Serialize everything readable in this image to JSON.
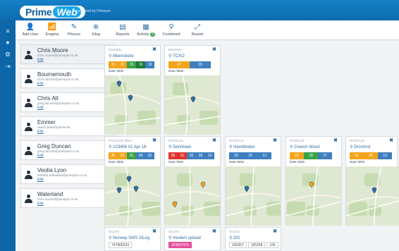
{
  "brand": {
    "prime": "Prime",
    "web": "Web",
    "powered": "powered by Primayer"
  },
  "colors": {
    "orange": "#f2a51c",
    "green": "#3aa34a",
    "darkgreen": "#1d7a3a",
    "blue": "#3f7fbf",
    "red": "#e0362c",
    "pink": "#e64f9b"
  },
  "toolbar": [
    {
      "label": "Add User",
      "icon": "user-plus-icon",
      "glyph": "👤"
    },
    {
      "label": "Enigma",
      "icon": "bars-icon",
      "glyph": "📶"
    },
    {
      "label": "Phocus",
      "icon": "edit-icon",
      "glyph": "✎"
    },
    {
      "label": "Xilog",
      "icon": "plus-circle-icon",
      "glyph": "⊕"
    },
    {
      "label": "Reports",
      "icon": "report-icon",
      "glyph": "▤"
    },
    {
      "label": "Activity",
      "icon": "activity-icon",
      "glyph": "▦",
      "badge": "3"
    },
    {
      "label": "Combined",
      "icon": "pin-icon",
      "glyph": "⚲"
    },
    {
      "label": "Resize",
      "icon": "resize-icon",
      "glyph": "⤢"
    }
  ],
  "sidenav": [
    {
      "icon": "menu-icon",
      "glyph": "≡"
    },
    {
      "icon": "globe-icon",
      "glyph": "●"
    },
    {
      "icon": "cogs-icon",
      "glyph": "⚙"
    },
    {
      "icon": "logout-icon",
      "glyph": "⇥"
    }
  ],
  "users": [
    {
      "name": "Chris Moore",
      "email": "chris.moore@primayer.co.uk",
      "edit": "Edit"
    },
    {
      "name": "Bournemouth",
      "email": "Chris.Moore@primayer.co.uk",
      "edit": "Edit"
    },
    {
      "name": "Chris Alt",
      "email": "greg.duncan@primayer.co.uk",
      "edit": "Edit"
    },
    {
      "name": "Emmer",
      "email": "switch.base@primer.be",
      "edit": "Edit"
    },
    {
      "name": "Greg Duncan",
      "email": "greg.duncan@primayer.co.uk",
      "edit": "Edit"
    },
    {
      "name": "Veolia Lyon",
      "email": "barbara.hathaway@primayer.co.uk",
      "edit": "Edit"
    },
    {
      "name": "Waterland",
      "email": "chris.moore@primayer.co.uk",
      "edit": "Edit"
    }
  ],
  "cards": [
    {
      "type": "ENIGMA",
      "location": "Meersbuke",
      "data_label": "Data Table",
      "values": [
        {
          "v": "21",
          "c": "orange"
        },
        {
          "v": "21",
          "c": "orange"
        },
        {
          "v": "19",
          "c": "green"
        },
        {
          "v": "19",
          "c": "darkgreen"
        },
        {
          "v": "19",
          "c": "blue"
        }
      ]
    },
    {
      "type": "ENIGMA",
      "location": "TCXO",
      "data_label": "Data Table",
      "values": [
        {
          "v": "27",
          "c": "orange"
        },
        {
          "v": "29",
          "c": "blue"
        }
      ]
    },
    {
      "type": "PHOCUS DMA",
      "location": "123456 01 Apr 16",
      "data_label": "Data Table",
      "values": [
        {
          "v": "26",
          "c": "orange"
        },
        {
          "v": "26",
          "c": "orange"
        },
        {
          "v": "31",
          "c": "green"
        },
        {
          "v": "34",
          "c": "blue"
        },
        {
          "v": "63",
          "c": "blue"
        }
      ]
    },
    {
      "type": "PHOCUS",
      "location": "Dennheet",
      "data_label": "Data Table",
      "values": [
        {
          "v": "55",
          "c": "red"
        },
        {
          "v": "31",
          "c": "red"
        },
        {
          "v": "20",
          "c": "blue"
        },
        {
          "v": "39",
          "c": "blue"
        },
        {
          "v": "19",
          "c": "blue"
        }
      ]
    },
    {
      "type": "PHOCUS",
      "location": "Hambledon",
      "data_label": "Data Table",
      "values": [
        {
          "v": "33",
          "c": "blue"
        },
        {
          "v": "19",
          "c": "blue"
        },
        {
          "v": "13",
          "c": "blue"
        }
      ]
    },
    {
      "type": "PHOCUS",
      "location": "Creech Wood",
      "data_label": "Data Table",
      "values": [
        {
          "v": "23",
          "c": "orange"
        },
        {
          "v": "18",
          "c": "green"
        },
        {
          "v": "27",
          "c": "blue"
        }
      ]
    },
    {
      "type": "PHOCUS",
      "location": "Droxford",
      "data_label": "Data Table",
      "values": [
        {
          "v": "31",
          "c": "orange"
        },
        {
          "v": "26",
          "c": "orange"
        },
        {
          "v": "19",
          "c": "blue"
        }
      ]
    }
  ],
  "small_cards": [
    {
      "type": "XILOG",
      "location": "Norway SMS XiLog",
      "values": [
        {
          "v": "747809233",
          "pink": false
        }
      ]
    },
    {
      "type": "XILOG",
      "location": "modem upload",
      "values": [
        {
          "v": "324007475",
          "pink": true
        }
      ]
    },
    {
      "type": "XILOG",
      "location": "DO",
      "values": [
        {
          "v": "155357",
          "pink": false
        },
        {
          "v": "155358",
          "pink": false
        },
        {
          "v": "155",
          "pink": false
        }
      ]
    }
  ]
}
